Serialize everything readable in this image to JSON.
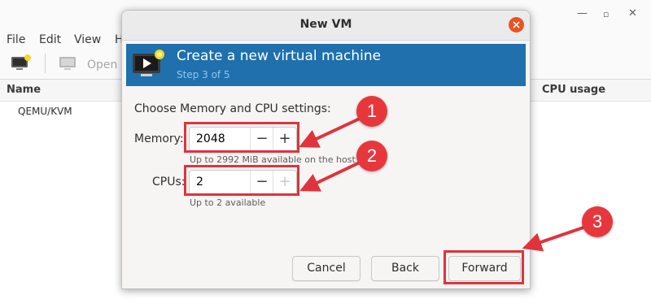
{
  "background_window": {
    "menu": [
      "File",
      "Edit",
      "View",
      "H"
    ],
    "toolbar_open_label": "Open",
    "columns": {
      "name": "Name",
      "cpu_usage": "CPU usage"
    },
    "connections": [
      "QEMU/KVM"
    ]
  },
  "dialog": {
    "title": "New VM",
    "banner_title": "Create a new virtual machine",
    "banner_step": "Step 3 of 5",
    "section_label": "Choose Memory and CPU settings:",
    "memory": {
      "label": "Memory:",
      "value": "2048",
      "hint": "Up to 2992 MiB available on the host"
    },
    "cpus": {
      "label": "CPUs:",
      "value": "2",
      "hint": "Up to 2 available"
    },
    "spin_minus": "−",
    "spin_plus": "+",
    "buttons": {
      "cancel": "Cancel",
      "back": "Back",
      "forward": "Forward"
    }
  },
  "annotations": {
    "one": "1",
    "two": "2",
    "three": "3"
  },
  "colors": {
    "banner": "#1f70ac",
    "annotation": "#e0333c",
    "close": "#e95420"
  }
}
